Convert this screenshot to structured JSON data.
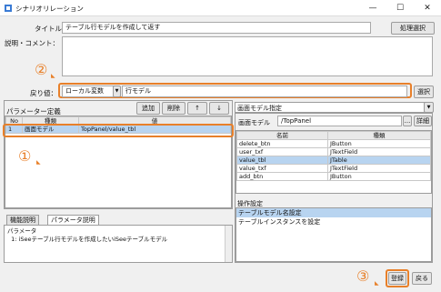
{
  "window": {
    "title": "シナリオリレーション",
    "minimize": "—",
    "maximize": "☐",
    "close": "✕"
  },
  "form": {
    "title_label": "タイトル：",
    "title_value": "テーブル行モデルを作成して返す",
    "select_button": "処理選択",
    "comment_label": "説明・コメント：",
    "return_label": "戻り値：",
    "return_type": "ローカル変数",
    "return_value": "行モデル",
    "return_select": "選択"
  },
  "params": {
    "header": "パラメーター定義",
    "add": "追加",
    "delete": "削除",
    "up": "↑",
    "down": "↓",
    "columns": [
      "No",
      "種類",
      "値"
    ],
    "rows": [
      [
        "1",
        "画面モデル",
        "TopPanel/value_tbl"
      ]
    ]
  },
  "screen": {
    "header": "画面モデル指定",
    "model_label": "画面モデル",
    "model_value": "/TopPanel",
    "browse": "...",
    "detail": "詳細",
    "columns": [
      "名前",
      "種類"
    ],
    "rows": [
      [
        "delete_btn",
        "JButton"
      ],
      [
        "user_txf",
        "JTextField"
      ],
      [
        "value_tbl",
        "JTable"
      ],
      [
        "value_txf",
        "JTextField"
      ],
      [
        "add_btn",
        "JButton"
      ]
    ],
    "selected_row": 2
  },
  "ops": {
    "header": "操作設定",
    "items": [
      "テーブルモデル名設定",
      "テーブルインスタンスを設定"
    ],
    "selected": 0
  },
  "help": {
    "tabs": [
      "機能説明",
      "パラメータ説明"
    ],
    "active_tab": 1,
    "lines": [
      "パラメータ",
      "  1: iSeeテーブル行モデルを作成したいiSeeテーブルモデル"
    ]
  },
  "footer": {
    "register": "登録",
    "back": "戻る"
  },
  "callouts": {
    "one": "①",
    "two": "②",
    "three": "③"
  },
  "colors": {
    "highlight": "#e8802a",
    "selection": "#b8d4f0"
  }
}
